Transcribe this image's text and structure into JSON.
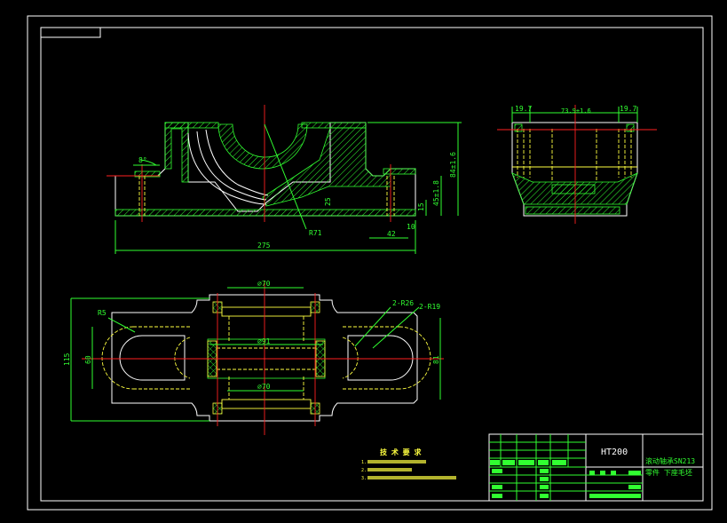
{
  "front_view": {
    "angle": "8°",
    "height_overall": "84±1.6",
    "height_mid": "25",
    "height_center": "45±1.8",
    "height_small": "15",
    "width_total": "275",
    "offset": "42",
    "step": "10",
    "radius": "R71"
  },
  "side_view": {
    "left": "19.7",
    "middle": "73.9±1.6",
    "right": "19.7"
  },
  "top_view": {
    "diameter_top": "⌀70",
    "diameter_mid": "⌀91",
    "diameter_bottom": "⌀70",
    "radius_small": "R5",
    "radius_a": "2-R26",
    "radius_b": "2-R19",
    "height_outer": "115",
    "height_inner": "60",
    "height_right": "81"
  },
  "notes": {
    "title": "技 术 要 求",
    "items": [
      "1.",
      "2.",
      "3."
    ]
  },
  "title_block": {
    "material": "HT200",
    "name_line1": "滚动轴承SN213",
    "name_line2": "零件  下座毛坯"
  },
  "colors": {
    "outline": "#ffffff",
    "hatch": "#31ff31",
    "hidden": "#ffff40",
    "center": "#ff2020"
  }
}
